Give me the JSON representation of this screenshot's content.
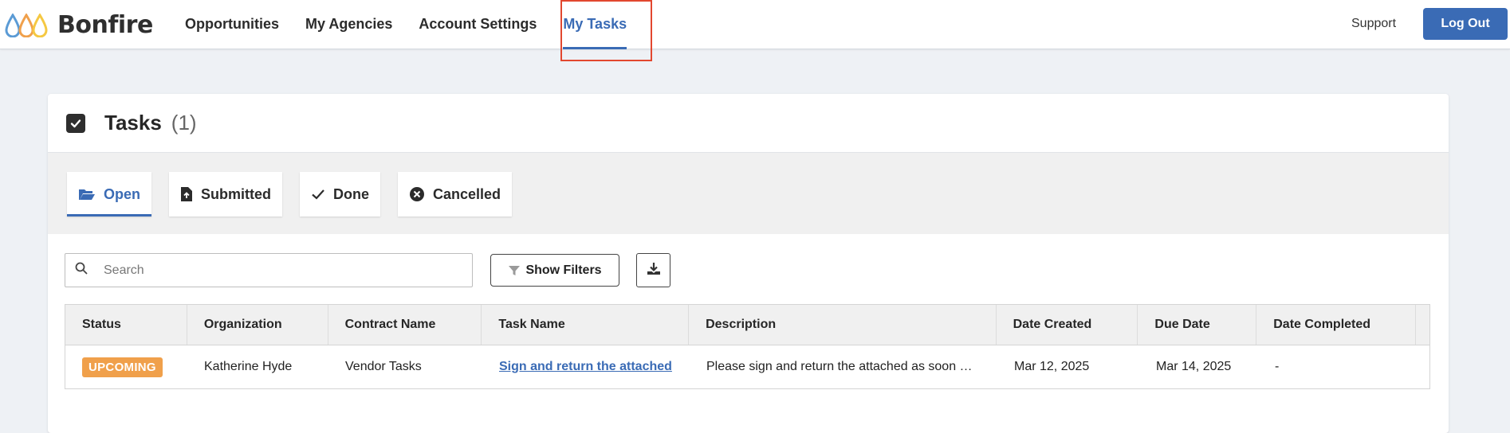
{
  "brand": {
    "name": "Bonfire",
    "accent": "#3a6bb5",
    "logo_colors": [
      "#5b9bd5",
      "#f0a04b",
      "#f5c842"
    ]
  },
  "nav": {
    "items": [
      {
        "label": "Opportunities"
      },
      {
        "label": "My Agencies"
      },
      {
        "label": "Account Settings"
      },
      {
        "label": "My Tasks",
        "active": true
      }
    ],
    "support": "Support",
    "logout": "Log Out"
  },
  "tasks_card": {
    "title": "Tasks",
    "count": "(1)",
    "tabs": [
      {
        "label": "Open",
        "icon": "folder-open-icon",
        "active": true
      },
      {
        "label": "Submitted",
        "icon": "file-upload-icon"
      },
      {
        "label": "Done",
        "icon": "checkmark-icon"
      },
      {
        "label": "Cancelled",
        "icon": "times-circle-icon"
      }
    ],
    "search": {
      "placeholder": "Search",
      "value": ""
    },
    "show_filters": "Show Filters",
    "table": {
      "columns": [
        "Status",
        "Organization",
        "Contract Name",
        "Task Name",
        "Description",
        "Date Created",
        "Due Date",
        "Date Completed"
      ],
      "rows": [
        {
          "status": "UPCOMING",
          "status_color": "#f0a04b",
          "organization": "Katherine Hyde",
          "contract_name": "Vendor Tasks",
          "task_name": "Sign and return the attached",
          "description": "Please sign and return the attached as soon …",
          "date_created": "Mar 12, 2025",
          "due_date": "Mar 14, 2025",
          "date_completed": "-"
        }
      ]
    }
  }
}
